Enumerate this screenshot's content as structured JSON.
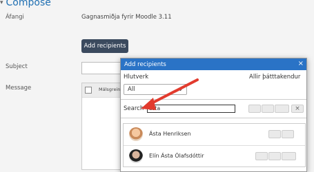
{
  "page": {
    "section_title": "Compose",
    "course_label": "Áfangi",
    "course_value": "Gagnasmiðja fyrir Moodle 3.11",
    "add_recipients_button": "Add recipients",
    "subject_label": "Subject",
    "message_label": "Message",
    "editor_toolbar_label": "Málsgrein"
  },
  "modal": {
    "title": "Add recipients",
    "close": "×",
    "role_label": "Hlutverk",
    "role_selected": "All",
    "participants_label": "Allir þátttakendur",
    "search_label": "Search",
    "search_value": "ásta",
    "clear_icon": "×",
    "results": [
      {
        "name": "Ásta Henriksen"
      },
      {
        "name": "Elín Ásta Ólafsdóttir"
      }
    ]
  },
  "colors": {
    "accent": "#2a73c6",
    "annotation_arrow": "#e23b2e"
  }
}
